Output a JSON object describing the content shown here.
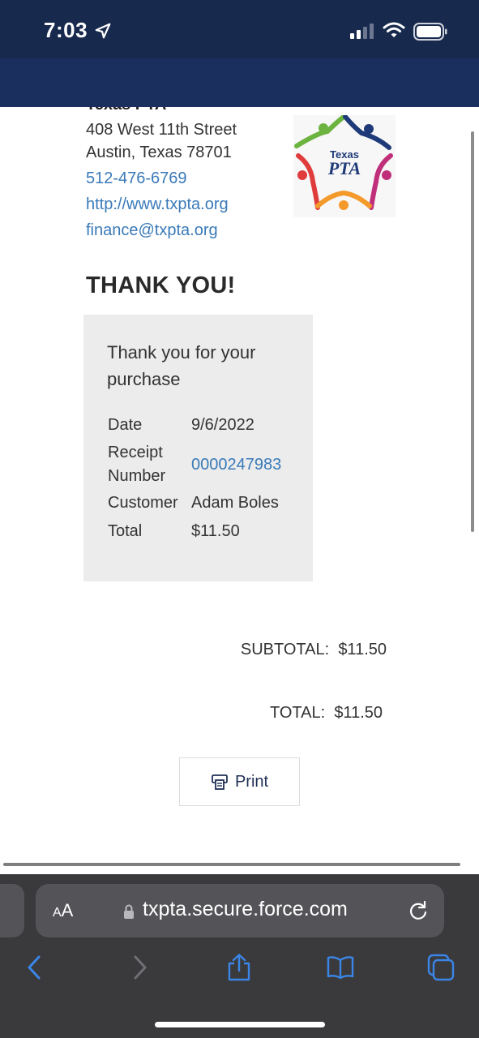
{
  "status_bar": {
    "time": "7:03"
  },
  "org": {
    "name_cut": "Texas PTA",
    "address_line1": "408 West 11th Street",
    "address_line2": "Austin, Texas 78701",
    "phone": "512-476-6769",
    "website": "http://www.txpta.org",
    "email": "finance@txpta.org",
    "logo_text_top": "Texas",
    "logo_text_main": "PTA"
  },
  "page": {
    "title": "THANK YOU!",
    "receipt_heading": "Thank you for your purchase"
  },
  "receipt": {
    "date_label": "Date",
    "date_value": "9/6/2022",
    "receipt_label_1": "Receipt",
    "receipt_label_2": "Number",
    "receipt_value": "0000247983",
    "customer_label": "Customer",
    "customer_value": "Adam Boles",
    "total_label": "Total",
    "total_value": "$11.50"
  },
  "summary": {
    "subtotal_label": "SUBTOTAL:",
    "subtotal_value": "$11.50",
    "total_label": "TOTAL:",
    "total_value": "$11.50"
  },
  "actions": {
    "print_label": "Print"
  },
  "browser": {
    "aa_label_small": "A",
    "aa_label_big": "A",
    "url": "txpta.secure.force.com"
  },
  "colors": {
    "status_bar_bg": "#17294d",
    "nav_band_bg": "#1a2f5e",
    "link": "#3a7ab8",
    "receipt_box_bg": "#ececec",
    "safari_toolbar_bg": "#3a3a3c",
    "safari_accent": "#3a86e8"
  },
  "icons": {
    "status": [
      "location-arrow-icon",
      "signal-icon",
      "wifi-icon",
      "battery-icon"
    ],
    "print": "printer-icon",
    "browser": [
      "lock-icon",
      "reload-icon",
      "back-icon",
      "forward-icon",
      "share-icon",
      "bookmarks-icon",
      "tabs-icon"
    ]
  }
}
